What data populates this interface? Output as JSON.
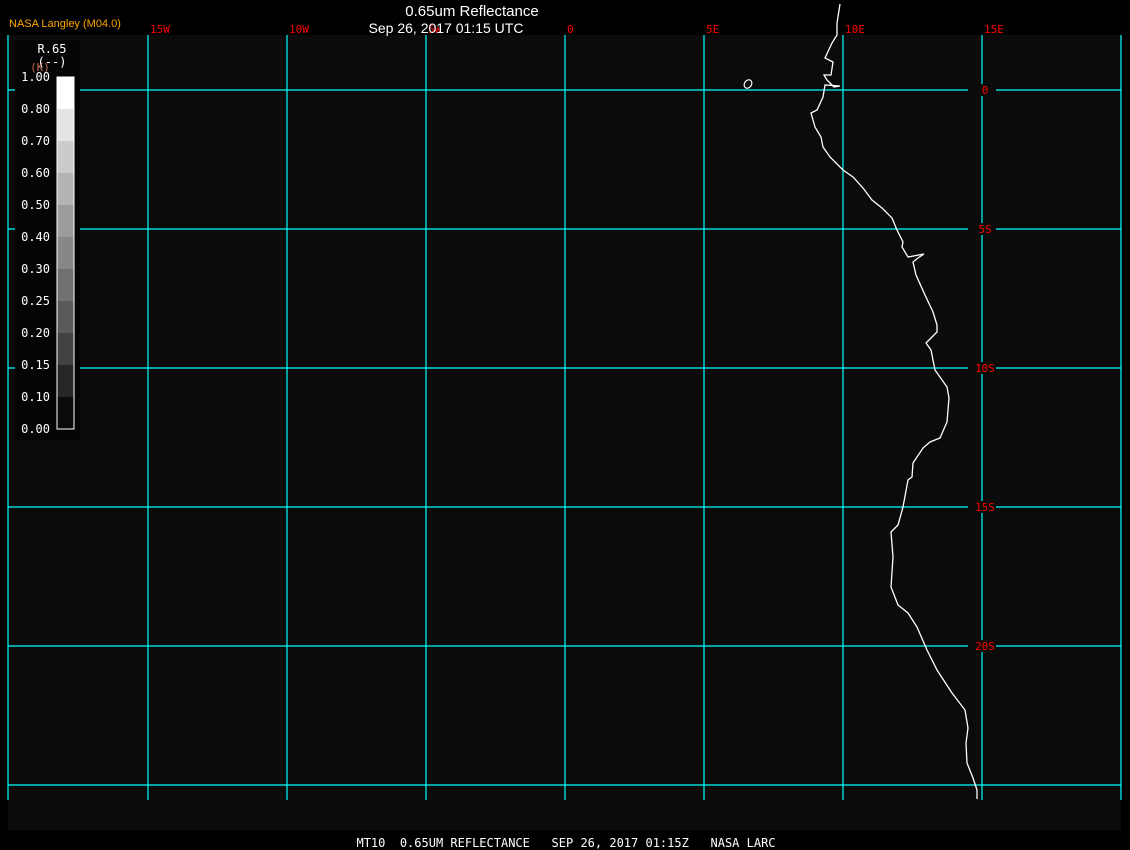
{
  "header": {
    "credit": "NASA Langley (M04.0)",
    "title": "0.65um Reflectance",
    "datetime": "Sep 26, 2017 01:15 UTC"
  },
  "footer": {
    "caption": "MT10  0.65UM REFLECTANCE   SEP 26, 2017 01:15Z   NASA LARC"
  },
  "legend": {
    "variable": "R.65",
    "units": "(--)",
    "units_alt": "(K)",
    "labels": [
      "1.00",
      "0.80",
      "0.70",
      "0.60",
      "0.50",
      "0.40",
      "0.30",
      "0.25",
      "0.20",
      "0.15",
      "0.10",
      "0.00"
    ],
    "colors": [
      "#ffffff",
      "#e4e4e4",
      "#cbcbcb",
      "#b4b4b4",
      "#9c9c9c",
      "#878787",
      "#717171",
      "#5a5a5a",
      "#424242",
      "#262626",
      "#0b0b0b"
    ]
  },
  "map": {
    "longitude_labels": [
      "15W",
      "10W",
      "5W",
      "0",
      "5E",
      "10E",
      "15E"
    ],
    "latitude_labels": [
      "0",
      "5S",
      "10S",
      "15S",
      "20S"
    ],
    "colors": {
      "grid": "#00ffff",
      "label": "#ff0000",
      "coast": "#ffffff",
      "background": "#0b0b0b",
      "credit": "#ffa500"
    }
  }
}
